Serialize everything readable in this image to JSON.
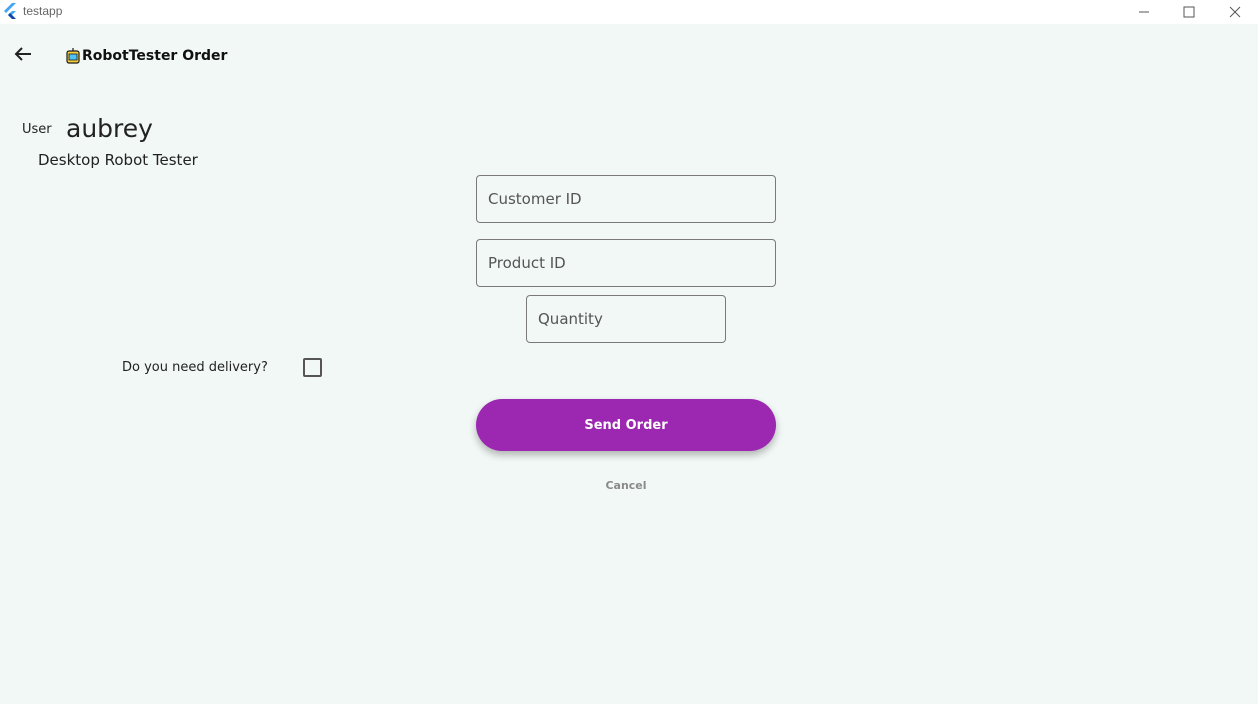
{
  "window": {
    "app_title": "testapp",
    "controls": {
      "minimize_icon": "minimize-icon",
      "maximize_icon": "maximize-icon",
      "close_icon": "close-icon"
    }
  },
  "appbar": {
    "back_icon": "arrow-left-icon",
    "logo_icon": "robot-logo-icon",
    "title": "RobotTester Order"
  },
  "user": {
    "label": "User",
    "name": "aubrey",
    "role": "Desktop Robot Tester"
  },
  "form": {
    "customer_id_placeholder": "Customer ID",
    "product_id_placeholder": "Product ID",
    "quantity_placeholder": "Quantity",
    "delivery_label": "Do you need delivery?",
    "delivery_checked": false,
    "send_label": "Send Order",
    "cancel_label": "Cancel"
  },
  "colors": {
    "background": "#f2f8f6",
    "primary": "#9c27b0",
    "cancel_text": "#8a8a8a"
  }
}
